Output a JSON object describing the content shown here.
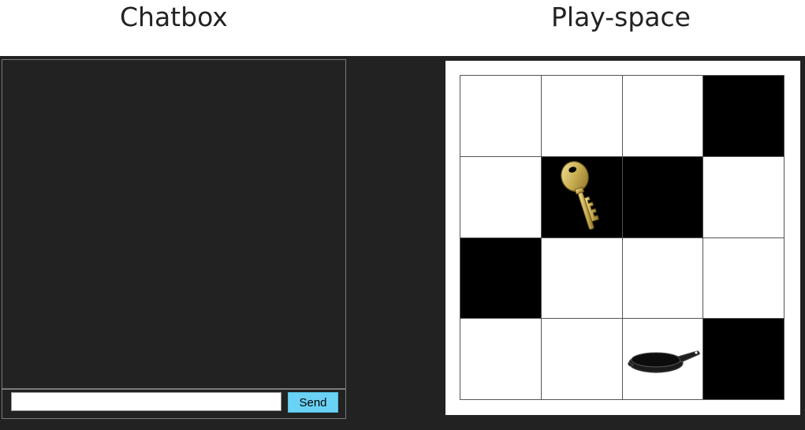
{
  "headings": {
    "chat": "Chatbox",
    "play": "Play-space"
  },
  "chat": {
    "input_value": "",
    "input_placeholder": "",
    "send_label": "Send"
  },
  "grid": {
    "rows": 4,
    "cols": 4,
    "cells": [
      [
        "white",
        "white",
        "white",
        "black"
      ],
      [
        "white",
        "black",
        "black",
        "white"
      ],
      [
        "black",
        "white",
        "white",
        "white"
      ],
      [
        "white",
        "white",
        "white",
        "black"
      ]
    ],
    "items": [
      {
        "row": 1,
        "col": 1,
        "icon": "key-icon"
      },
      {
        "row": 3,
        "col": 2,
        "icon": "frying-pan-icon"
      }
    ]
  },
  "colors": {
    "stage_bg": "#222222",
    "send_button": "#6ad3f5",
    "cell_white": "#ffffff",
    "cell_black": "#000000"
  }
}
